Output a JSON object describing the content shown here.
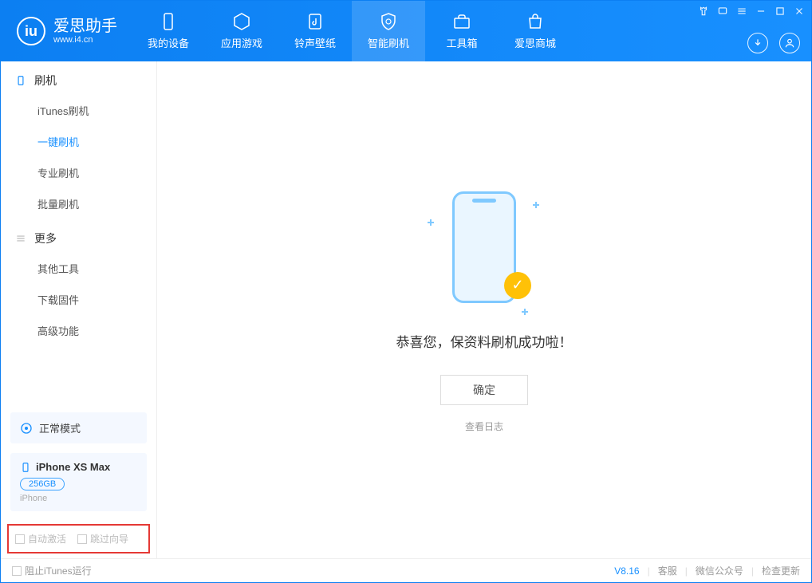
{
  "app": {
    "name": "爱思助手",
    "url": "www.i4.cn"
  },
  "nav": {
    "my_device": "我的设备",
    "app_games": "应用游戏",
    "ring_wall": "铃声壁纸",
    "smart_flash": "智能刷机",
    "toolbox": "工具箱",
    "store": "爱思商城"
  },
  "sidebar": {
    "section_flash": "刷机",
    "itunes_flash": "iTunes刷机",
    "one_key_flash": "一键刷机",
    "pro_flash": "专业刷机",
    "batch_flash": "批量刷机",
    "section_more": "更多",
    "other_tools": "其他工具",
    "download_fw": "下载固件",
    "advanced": "高级功能",
    "mode_label": "正常模式",
    "device_name": "iPhone XS Max",
    "device_storage": "256GB",
    "device_type": "iPhone",
    "auto_activate": "自动激活",
    "skip_guide": "跳过向导"
  },
  "main": {
    "success_msg": "恭喜您，保资料刷机成功啦！",
    "ok_btn": "确定",
    "view_log": "查看日志"
  },
  "status": {
    "block_itunes": "阻止iTunes运行",
    "version": "V8.16",
    "support": "客服",
    "wechat": "微信公众号",
    "check_update": "检查更新"
  }
}
